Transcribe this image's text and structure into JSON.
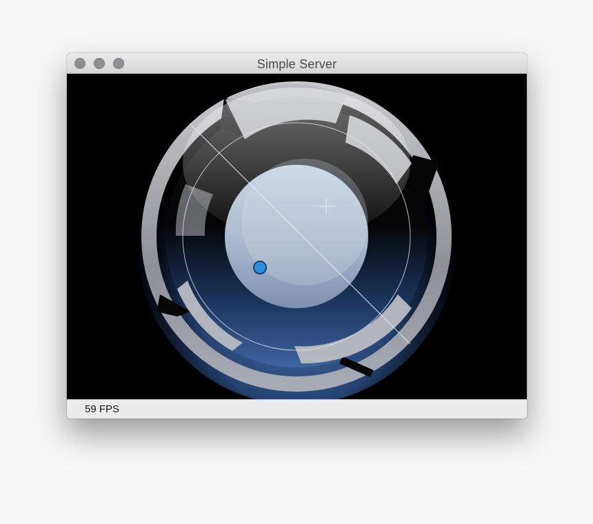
{
  "window": {
    "title": "Simple Server"
  },
  "status": {
    "fps_text": "59 FPS"
  },
  "scene": {
    "description_free": true,
    "colors": {
      "background": "#000000",
      "ring_gray": "#9b9ca0",
      "gear_light": "#c9ccd1",
      "knob_top": "#c4d4e2",
      "knob_bottom": "#8594b2",
      "glow_blue": "#3a5f9a",
      "marker": "#2f8fe0"
    },
    "icons": {
      "marker": "circle-marker-icon",
      "crosshair": "crosshair-icon"
    }
  }
}
